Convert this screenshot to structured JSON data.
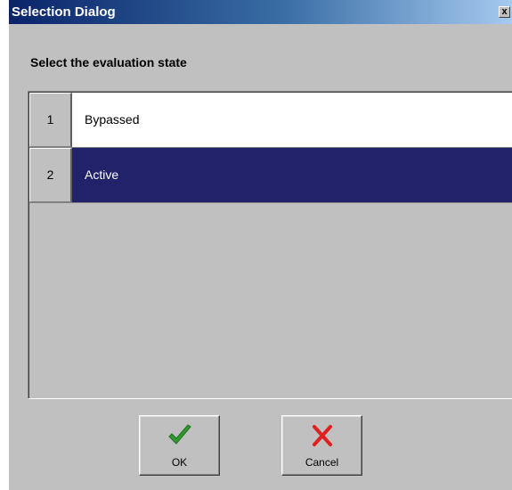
{
  "window": {
    "title": "Selection Dialog",
    "close_label": "x"
  },
  "prompt": "Select the evaluation state",
  "options": [
    {
      "number": "1",
      "label": "Bypassed",
      "selected": false
    },
    {
      "number": "2",
      "label": "Active",
      "selected": true
    }
  ],
  "buttons": {
    "ok": {
      "label": "OK",
      "icon": "checkmark-icon",
      "color": "#2e9a2e"
    },
    "cancel": {
      "label": "Cancel",
      "icon": "cross-icon",
      "color": "#e02020"
    }
  },
  "colors": {
    "selection": "#22226b",
    "face": "#c0c0c0"
  }
}
